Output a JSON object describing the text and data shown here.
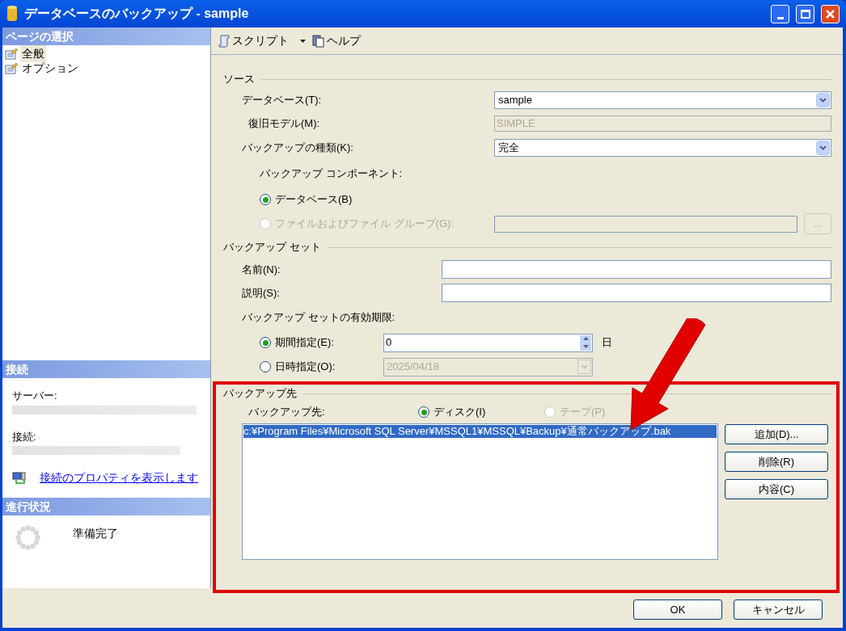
{
  "window": {
    "title": "データベースのバックアップ - sample"
  },
  "sidebar": {
    "header": "ページの選択",
    "items": [
      {
        "label": "全般",
        "selected": true
      },
      {
        "label": "オプション",
        "selected": false
      }
    ]
  },
  "connection": {
    "header": "接続",
    "server_label": "サーバー:",
    "connection_label": "接続:",
    "link": "接続のプロパティを表示します"
  },
  "progress": {
    "header": "進行状況",
    "status": "準備完了"
  },
  "toolbar": [
    {
      "label": "スクリプト",
      "dropdown": true
    },
    {
      "label": "ヘルプ",
      "dropdown": false
    }
  ],
  "source": {
    "title": "ソース",
    "database": {
      "label": "データベース(T):",
      "value": "sample"
    },
    "recovery_model": {
      "label": "復旧モデル(M):",
      "value": "SIMPLE"
    },
    "backup_type": {
      "label": "バックアップの種類(K):",
      "value": "完全"
    },
    "component_label": "バックアップ コンポーネント:",
    "components": [
      {
        "label": "データベース(B)",
        "selected": true,
        "disabled": false
      },
      {
        "label": "ファイルおよびファイル グループ(G):",
        "selected": false,
        "disabled": true
      }
    ],
    "browse_button": "..."
  },
  "backup_set": {
    "title": "バックアップ セット",
    "name_label": "名前(N):",
    "description_label": "説明(S):",
    "expiry_label": "バックアップ セットの有効期限:",
    "expiry_options": [
      {
        "kind": "spin",
        "label": "期間指定(E):",
        "selected": true,
        "value": "0",
        "unit": "日"
      },
      {
        "kind": "date",
        "label": "日時指定(O):",
        "selected": false,
        "value": "2025/04/18"
      }
    ]
  },
  "destination": {
    "title": "バックアップ先",
    "label": "バックアップ先:",
    "media": [
      {
        "label": "ディスク(I)",
        "selected": true,
        "disabled": false
      },
      {
        "label": "テープ(P)",
        "selected": false,
        "disabled": true
      }
    ],
    "paths": [
      {
        "text": "c:¥Program Files¥Microsoft SQL Server¥MSSQL1¥MSSQL¥Backup¥通常バックアップ.bak",
        "selected": true
      }
    ],
    "buttons": [
      "追加(D)...",
      "削除(R)",
      "内容(C)"
    ]
  },
  "footer_buttons": [
    "OK",
    "キャンセル"
  ]
}
